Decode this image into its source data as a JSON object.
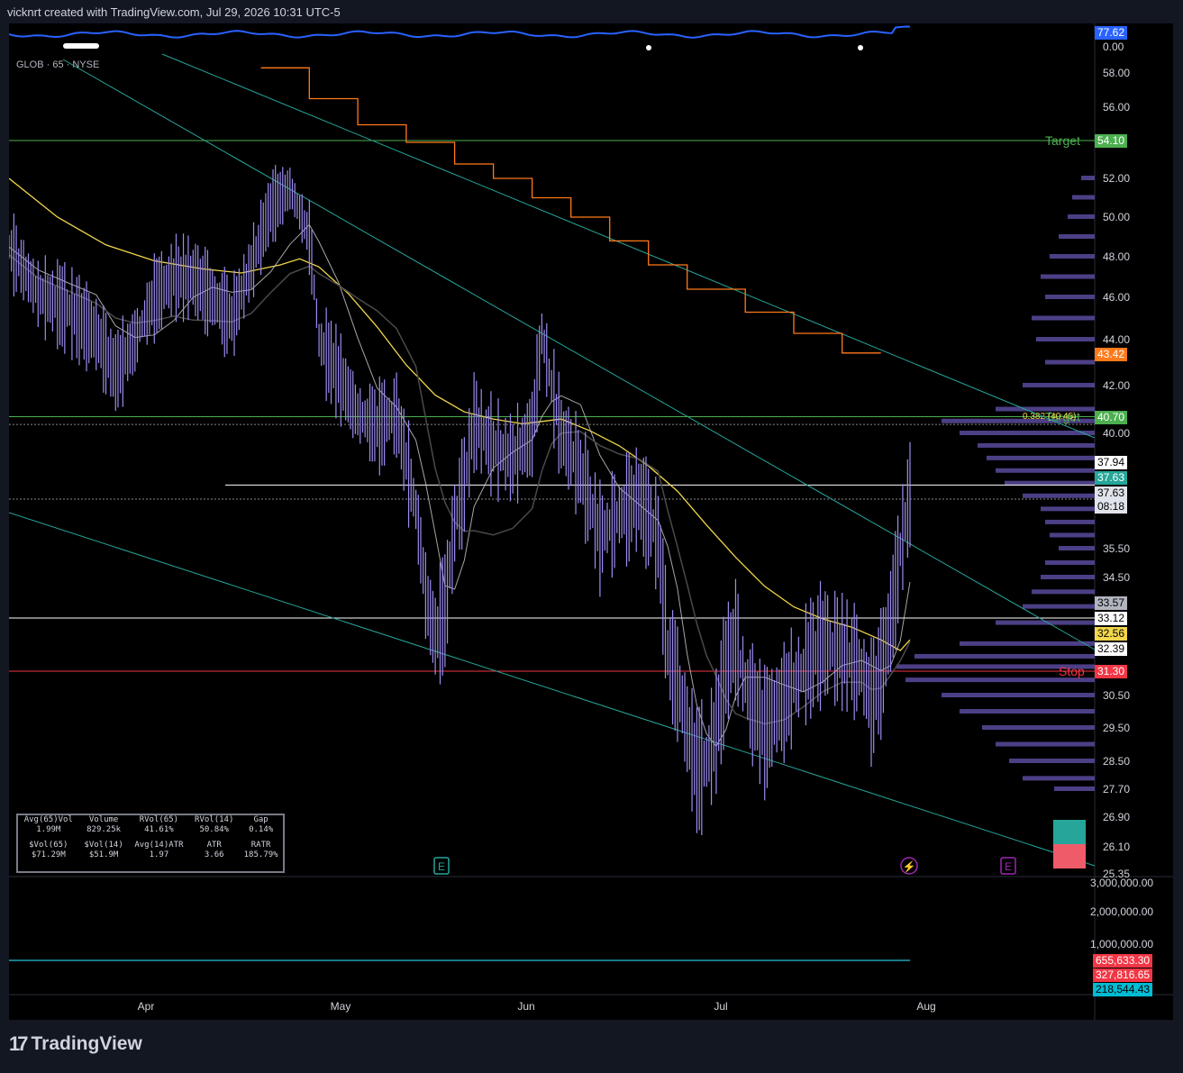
{
  "header": {
    "created_by": "vicknrt created with TradingView.com, Jul 29, 2026 10:31 UTC-5"
  },
  "symbol": {
    "label": "GLOB · 65 · NYSE"
  },
  "footer": {
    "brand": "TradingView"
  },
  "colors": {
    "candle": "#9c8cf0",
    "yellow_ma": "#f2d64b",
    "orange_stop": "#ff7a1a",
    "channel": "#26a69a",
    "target": "#4caf50",
    "stop": "#f23645",
    "indicator": "#2962ff"
  },
  "indicator_pane": {
    "value_tag": "77.62",
    "zero_label": "0.00"
  },
  "price_axis": {
    "ticks": [
      "58.00",
      "56.00",
      "52.00",
      "50.00",
      "48.00",
      "46.00",
      "44.00",
      "42.00",
      "40.00",
      "35.50",
      "34.50",
      "30.50",
      "29.50",
      "28.50",
      "27.70",
      "26.90",
      "26.10",
      "25.35"
    ]
  },
  "price_tags": [
    {
      "text": "54.10",
      "bg": "#4caf50",
      "fg": "#ffffff"
    },
    {
      "text": "43.42",
      "bg": "#ff7a1a",
      "fg": "#ffffff"
    },
    {
      "text": "40.70",
      "bg": "#4caf50",
      "fg": "#ffffff"
    },
    {
      "text": "37.94",
      "bg": "#ffffff",
      "fg": "#000000"
    },
    {
      "text": "37.63",
      "bg": "#26a69a",
      "fg": "#ffffff"
    },
    {
      "text": "37.63",
      "bg": "#e0e3eb",
      "fg": "#000000"
    },
    {
      "text": "08:18",
      "bg": "#e0e3eb",
      "fg": "#000000"
    },
    {
      "text": "33.57",
      "bg": "#b2b5be",
      "fg": "#000000"
    },
    {
      "text": "33.12",
      "bg": "#ffffff",
      "fg": "#000000"
    },
    {
      "text": "32.56",
      "bg": "#f2d64b",
      "fg": "#000000"
    },
    {
      "text": "32.39",
      "bg": "#ffffff",
      "fg": "#000000"
    },
    {
      "text": "31.30",
      "bg": "#f23645",
      "fg": "#ffffff"
    }
  ],
  "levels": {
    "target_upper": {
      "label": "Target",
      "price": 54.1
    },
    "target_lower": {
      "label": "Target",
      "price": 40.7
    },
    "fib": {
      "label": "0.382 (40.45)",
      "price": 40.45
    },
    "stop": {
      "label": "Stop",
      "price": 31.3
    },
    "resistance": 37.94,
    "support": 33.12
  },
  "stats": {
    "headers_row1": [
      "Avg(65)Vol",
      "Volume",
      "RVol(65)",
      "RVol(14)",
      "Gap"
    ],
    "values_row1": [
      "1.99M",
      "829.25k",
      "41.61%",
      "50.84%",
      "0.14%"
    ],
    "headers_row2": [
      "$Vol(65)",
      "$Vol(14)",
      "Avg(14)ATR",
      "ATR",
      "RATR"
    ],
    "values_row2": [
      "$71.29M",
      "$51.9M",
      "1.97",
      "3.66",
      "185.79%"
    ]
  },
  "volume_axis": {
    "ticks": [
      "3,000,000.00",
      "2,000,000.00",
      "1,000,000.00"
    ],
    "tags": [
      {
        "text": "655,633.30",
        "bg": "#f23645",
        "fg": "#ffffff"
      },
      {
        "text": "327,816.65",
        "bg": "#f23645",
        "fg": "#ffffff"
      },
      {
        "text": "218,544.43",
        "bg": "#00bcd4",
        "fg": "#000000"
      }
    ]
  },
  "time_axis": {
    "labels": [
      "Apr",
      "May",
      "Jun",
      "Jul",
      "Aug"
    ]
  },
  "chart_data": {
    "type": "line",
    "title": "GLOB · 65 · NYSE",
    "x": [
      "Apr",
      "May",
      "Jun",
      "Jul",
      "Aug"
    ],
    "ylim": [
      25.35,
      59.0
    ],
    "series": [
      {
        "name": "price_path",
        "points": [
          [
            0,
            48.5
          ],
          [
            6,
            46.2
          ],
          [
            12,
            45.5
          ],
          [
            18,
            44.3
          ],
          [
            22,
            42.6
          ],
          [
            26,
            44.0
          ],
          [
            30,
            46.0
          ],
          [
            34,
            47.0
          ],
          [
            38,
            47.0
          ],
          [
            42,
            46.0
          ],
          [
            46,
            45.0
          ],
          [
            50,
            47.5
          ],
          [
            54,
            50.5
          ],
          [
            58,
            51.5
          ],
          [
            62,
            49.0
          ],
          [
            64,
            44.0
          ],
          [
            68,
            42.5
          ],
          [
            72,
            40.8
          ],
          [
            76,
            40.3
          ],
          [
            80,
            40.8
          ],
          [
            84,
            37.0
          ],
          [
            86,
            34.0
          ],
          [
            88,
            32.5
          ],
          [
            90,
            33.4
          ],
          [
            92,
            36.5
          ],
          [
            94,
            38.0
          ],
          [
            96,
            40.5
          ],
          [
            100,
            39.5
          ],
          [
            104,
            39.0
          ],
          [
            108,
            40.0
          ],
          [
            110,
            44.3
          ],
          [
            112,
            42.0
          ],
          [
            114,
            40.0
          ],
          [
            118,
            38.5
          ],
          [
            122,
            36.0
          ],
          [
            126,
            36.8
          ],
          [
            130,
            37.5
          ],
          [
            134,
            36.0
          ],
          [
            136,
            32.0
          ],
          [
            138,
            31.0
          ],
          [
            140,
            29.5
          ],
          [
            142,
            28.3
          ],
          [
            144,
            28.5
          ],
          [
            146,
            29.5
          ],
          [
            148,
            31.5
          ],
          [
            150,
            32.4
          ],
          [
            152,
            31.0
          ],
          [
            156,
            29.5
          ],
          [
            160,
            30.5
          ],
          [
            164,
            31.5
          ],
          [
            168,
            32.3
          ],
          [
            172,
            32.0
          ],
          [
            176,
            31.5
          ],
          [
            178,
            30.5
          ],
          [
            180,
            31.3
          ],
          [
            182,
            33.0
          ],
          [
            184,
            35.5
          ],
          [
            186,
            37.6
          ]
        ]
      },
      {
        "name": "yellow_ma",
        "points": [
          [
            0,
            52.0
          ],
          [
            10,
            50.0
          ],
          [
            20,
            48.6
          ],
          [
            30,
            47.8
          ],
          [
            40,
            47.4
          ],
          [
            48,
            47.2
          ],
          [
            56,
            47.6
          ],
          [
            60,
            47.9
          ],
          [
            64,
            47.5
          ],
          [
            70,
            46.2
          ],
          [
            76,
            44.6
          ],
          [
            82,
            42.9
          ],
          [
            88,
            41.6
          ],
          [
            94,
            40.9
          ],
          [
            100,
            40.6
          ],
          [
            106,
            40.4
          ],
          [
            110,
            40.5
          ],
          [
            114,
            40.6
          ],
          [
            120,
            40.1
          ],
          [
            126,
            39.5
          ],
          [
            132,
            38.7
          ],
          [
            138,
            37.7
          ],
          [
            144,
            36.4
          ],
          [
            150,
            35.2
          ],
          [
            156,
            34.2
          ],
          [
            162,
            33.5
          ],
          [
            168,
            33.1
          ],
          [
            174,
            32.9
          ],
          [
            180,
            32.6
          ],
          [
            184,
            32.3
          ],
          [
            186,
            32.6
          ]
        ]
      },
      {
        "name": "orange_stop",
        "points": [
          [
            52,
            58.3
          ],
          [
            62,
            58.3
          ],
          [
            62,
            56.5
          ],
          [
            72,
            56.5
          ],
          [
            72,
            55.0
          ],
          [
            82,
            55.0
          ],
          [
            82,
            54.0
          ],
          [
            92,
            54.0
          ],
          [
            92,
            52.8
          ],
          [
            100,
            52.8
          ],
          [
            100,
            52.0
          ],
          [
            108,
            52.0
          ],
          [
            108,
            51.0
          ],
          [
            116,
            51.0
          ],
          [
            116,
            50.0
          ],
          [
            124,
            50.0
          ],
          [
            124,
            48.8
          ],
          [
            132,
            48.8
          ],
          [
            132,
            47.6
          ],
          [
            140,
            47.6
          ],
          [
            140,
            46.4
          ],
          [
            152,
            46.4
          ],
          [
            152,
            45.3
          ],
          [
            162,
            45.3
          ],
          [
            162,
            44.3
          ],
          [
            172,
            44.3
          ],
          [
            172,
            43.42
          ],
          [
            180,
            43.42
          ]
        ]
      }
    ]
  }
}
